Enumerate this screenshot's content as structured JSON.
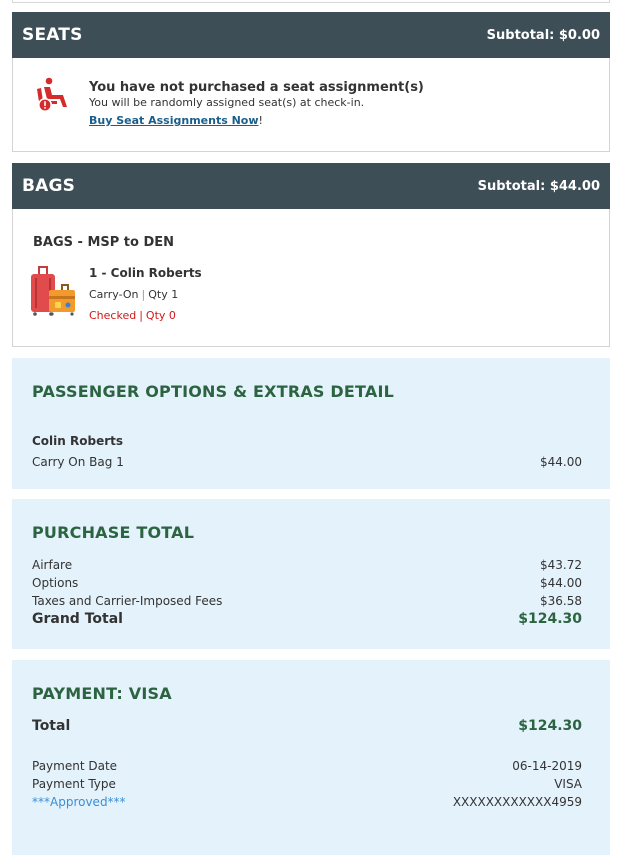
{
  "seats": {
    "title": "SEATS",
    "subtotal": "Subtotal: $0.00",
    "notice_title": "You have not purchased a seat assignment(s)",
    "notice_sub": "You will be randomly assigned seat(s) at check-in.",
    "link_label": "Buy Seat Assignments Now",
    "link_suffix": "!"
  },
  "bags": {
    "title": "BAGS",
    "subtotal": "Subtotal: $44.00",
    "route": "BAGS - MSP to DEN",
    "passenger": "1 - Colin Roberts",
    "carry_on_label": "Carry-On",
    "carry_on_qty": "Qty 1",
    "checked_label": "Checked",
    "checked_qty": "Qty 0",
    "separator": "|"
  },
  "options": {
    "title": "PASSENGER OPTIONS & EXTRAS DETAIL",
    "passenger": "Colin Roberts",
    "item_label": "Carry On Bag 1",
    "item_amount": "$44.00"
  },
  "purchase": {
    "title": "PURCHASE TOTAL",
    "rows": [
      {
        "label": "Airfare",
        "amount": "$43.72"
      },
      {
        "label": "Options",
        "amount": "$44.00"
      },
      {
        "label": "Taxes and Carrier-Imposed Fees",
        "amount": "$36.58"
      }
    ],
    "grand_label": "Grand Total",
    "grand_amount": "$124.30"
  },
  "payment": {
    "title": "PAYMENT: VISA",
    "total_label": "Total",
    "total_amount": "$124.30",
    "date_label": "Payment Date",
    "date_value": "06-14-2019",
    "type_label": "Payment Type",
    "type_value": "VISA",
    "status": "***Approved***",
    "card_number": "XXXXXXXXXXXX4959"
  },
  "colors": {
    "header_bg": "#3d4e56",
    "panel_bg": "#e4f2fb",
    "panel_title": "#2c6340",
    "alert_red": "#d01919",
    "link_blue": "#1a5e8c",
    "approved_blue": "#3a8ed6"
  },
  "icons": {
    "seat": "seat-alert-icon",
    "luggage": "luggage-icon"
  }
}
